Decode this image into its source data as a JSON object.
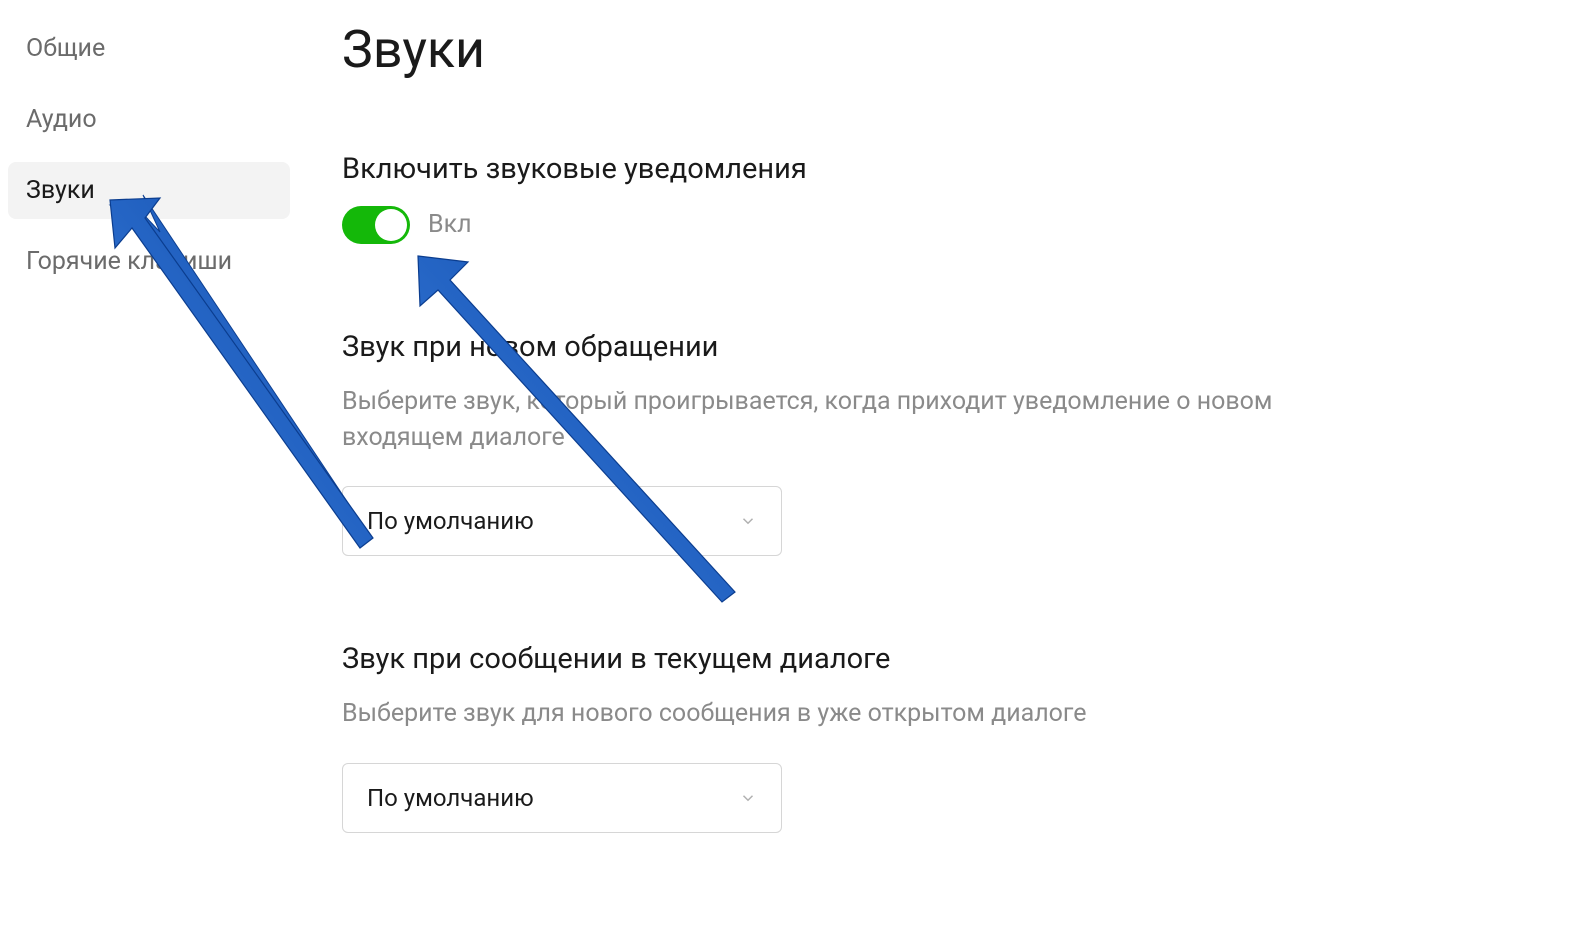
{
  "sidebar": {
    "items": [
      {
        "label": "Общие",
        "active": false
      },
      {
        "label": "Аудио",
        "active": false
      },
      {
        "label": "Звуки",
        "active": true
      },
      {
        "label": "Горячие клавиши",
        "active": false
      }
    ]
  },
  "page": {
    "title": "Звуки"
  },
  "enable_sound": {
    "title": "Включить звуковые уведомления",
    "toggle_state": "Вкл",
    "enabled": true
  },
  "new_request_sound": {
    "title": "Звук при новом обращении",
    "description": "Выберите звук, который проигрывается, когда приходит уведомление о новом входящем диалоге",
    "selected": "По умолчанию"
  },
  "current_dialog_sound": {
    "title": "Звук при сообщении в текущем диалоге",
    "description": "Выберите звук для нового сообщения в уже открытом диалоге",
    "selected": "По умолчанию"
  },
  "colors": {
    "toggle_on": "#14b809",
    "arrow": "#1d5fc7"
  }
}
